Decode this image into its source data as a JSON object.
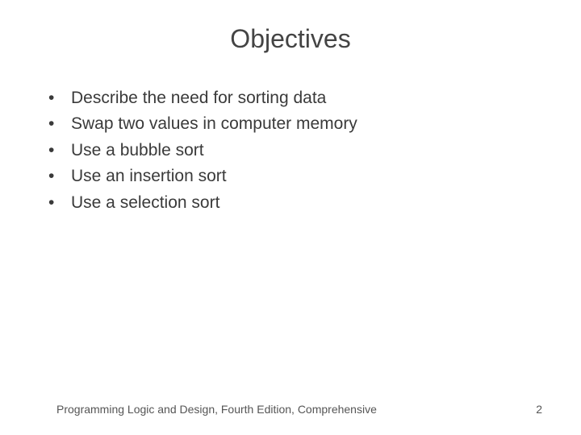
{
  "title": "Objectives",
  "bullets": [
    "Describe the need for sorting data",
    "Swap two values in computer memory",
    "Use a bubble sort",
    "Use an insertion sort",
    "Use a selection sort"
  ],
  "footer": {
    "text": "Programming Logic and Design, Fourth Edition, Comprehensive",
    "page": "2"
  }
}
